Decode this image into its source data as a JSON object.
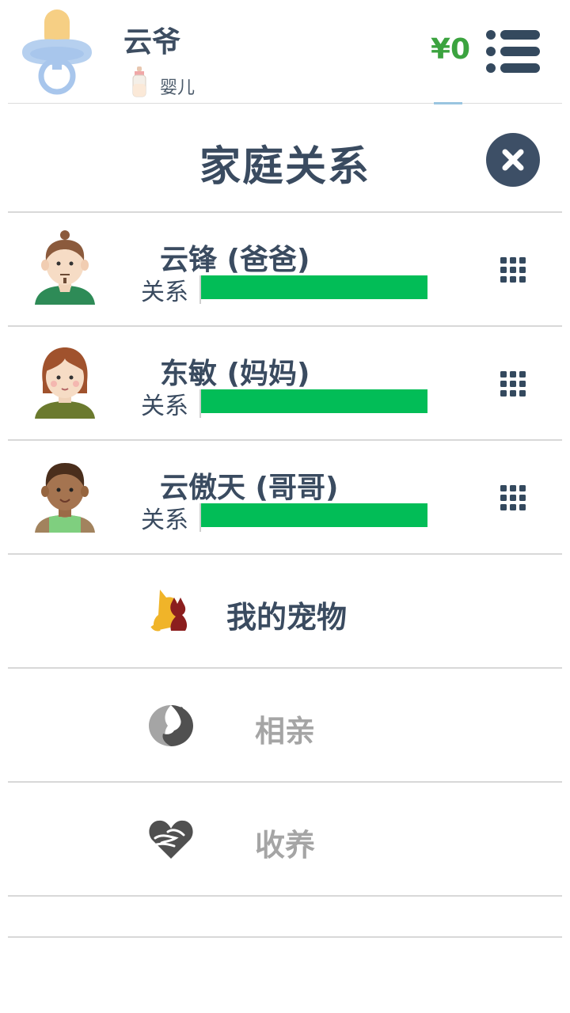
{
  "header": {
    "name": "云爷",
    "life_stage": "婴儿",
    "money": "¥0"
  },
  "dialog": {
    "title": "家庭关系",
    "members": [
      {
        "name": "云锋 (爸爸)",
        "relation_label": "关系",
        "relation_level": 1.0,
        "avatar": "father-avatar-icon"
      },
      {
        "name": "东敏 (妈妈)",
        "relation_label": "关系",
        "relation_level": 1.0,
        "avatar": "mother-avatar-icon"
      },
      {
        "name": "云傲天 (哥哥)",
        "relation_label": "关系",
        "relation_level": 1.0,
        "avatar": "brother-avatar-icon"
      }
    ],
    "options": [
      {
        "label": "我的宠物",
        "icon": "pets-icon",
        "enabled": true
      },
      {
        "label": "相亲",
        "icon": "matchmaking-icon",
        "enabled": false
      },
      {
        "label": "收养",
        "icon": "adopt-icon",
        "enabled": false
      }
    ]
  },
  "colors": {
    "relation_bar": "#02bd57",
    "money": "#3ba33f",
    "enabled_text": "#3a4b60",
    "disabled_text": "#a5a5a5"
  }
}
